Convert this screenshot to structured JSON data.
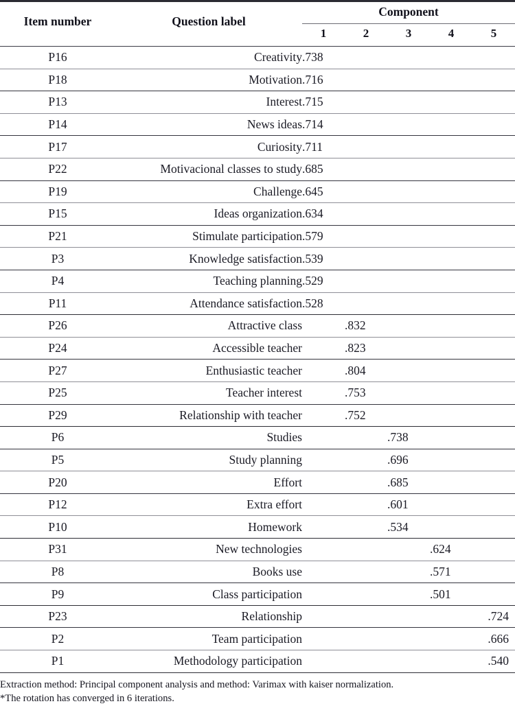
{
  "table": {
    "headers": {
      "item_number": "Item number",
      "question_label": "Question label",
      "component": "Component",
      "components": [
        "1",
        "2",
        "3",
        "4",
        "5"
      ]
    },
    "rows": [
      {
        "item": "P16",
        "label": "Creativity",
        "c1": ".738",
        "c2": "",
        "c3": "",
        "c4": "",
        "c5": ""
      },
      {
        "item": "P18",
        "label": "Motivation",
        "c1": ".716",
        "c2": "",
        "c3": "",
        "c4": "",
        "c5": ""
      },
      {
        "item": "P13",
        "label": "Interest",
        "c1": ".715",
        "c2": "",
        "c3": "",
        "c4": "",
        "c5": ""
      },
      {
        "item": "P14",
        "label": "News ideas",
        "c1": ".714",
        "c2": "",
        "c3": "",
        "c4": "",
        "c5": ""
      },
      {
        "item": "P17",
        "label": "Curiosity",
        "c1": ".711",
        "c2": "",
        "c3": "",
        "c4": "",
        "c5": ""
      },
      {
        "item": "P22",
        "label": "Motivacional classes to study",
        "c1": ".685",
        "c2": "",
        "c3": "",
        "c4": "",
        "c5": ""
      },
      {
        "item": "P19",
        "label": "Challenge",
        "c1": ".645",
        "c2": "",
        "c3": "",
        "c4": "",
        "c5": ""
      },
      {
        "item": "P15",
        "label": "Ideas organization",
        "c1": ".634",
        "c2": "",
        "c3": "",
        "c4": "",
        "c5": ""
      },
      {
        "item": "P21",
        "label": "Stimulate participation",
        "c1": ".579",
        "c2": "",
        "c3": "",
        "c4": "",
        "c5": ""
      },
      {
        "item": "P3",
        "label": "Knowledge satisfaction",
        "c1": ".539",
        "c2": "",
        "c3": "",
        "c4": "",
        "c5": ""
      },
      {
        "item": "P4",
        "label": "Teaching planning",
        "c1": ".529",
        "c2": "",
        "c3": "",
        "c4": "",
        "c5": ""
      },
      {
        "item": "P11",
        "label": "Attendance satisfaction",
        "c1": ".528",
        "c2": "",
        "c3": "",
        "c4": "",
        "c5": ""
      },
      {
        "item": "P26",
        "label": "Attractive class",
        "c1": "",
        "c2": ".832",
        "c3": "",
        "c4": "",
        "c5": ""
      },
      {
        "item": "P24",
        "label": "Accessible teacher",
        "c1": "",
        "c2": ".823",
        "c3": "",
        "c4": "",
        "c5": ""
      },
      {
        "item": "P27",
        "label": "Enthusiastic teacher",
        "c1": "",
        "c2": ".804",
        "c3": "",
        "c4": "",
        "c5": ""
      },
      {
        "item": "P25",
        "label": "Teacher interest",
        "c1": "",
        "c2": ".753",
        "c3": "",
        "c4": "",
        "c5": ""
      },
      {
        "item": "P29",
        "label": "Relationship with teacher",
        "c1": "",
        "c2": ".752",
        "c3": "",
        "c4": "",
        "c5": ""
      },
      {
        "item": "P6",
        "label": "Studies",
        "c1": "",
        "c2": "",
        "c3": ".738",
        "c4": "",
        "c5": ""
      },
      {
        "item": "P5",
        "label": "Study planning",
        "c1": "",
        "c2": "",
        "c3": ".696",
        "c4": "",
        "c5": ""
      },
      {
        "item": "P20",
        "label": "Effort",
        "c1": "",
        "c2": "",
        "c3": ".685",
        "c4": "",
        "c5": ""
      },
      {
        "item": "P12",
        "label": "Extra effort",
        "c1": "",
        "c2": "",
        "c3": ".601",
        "c4": "",
        "c5": ""
      },
      {
        "item": "P10",
        "label": "Homework",
        "c1": "",
        "c2": "",
        "c3": ".534",
        "c4": "",
        "c5": ""
      },
      {
        "item": "P31",
        "label": "New technologies",
        "c1": "",
        "c2": "",
        "c3": "",
        "c4": ".624",
        "c5": ""
      },
      {
        "item": "P8",
        "label": "Books use",
        "c1": "",
        "c2": "",
        "c3": "",
        "c4": ".571",
        "c5": ""
      },
      {
        "item": "P9",
        "label": "Class participation",
        "c1": "",
        "c2": "",
        "c3": "",
        "c4": ".501",
        "c5": ""
      },
      {
        "item": "P23",
        "label": "Relationship",
        "c1": "",
        "c2": "",
        "c3": "",
        "c4": "",
        "c5": ".724"
      },
      {
        "item": "P2",
        "label": "Team participation",
        "c1": "",
        "c2": "",
        "c3": "",
        "c4": "",
        "c5": ".666"
      },
      {
        "item": "P1",
        "label": "Methodology participation",
        "c1": "",
        "c2": "",
        "c3": "",
        "c4": "",
        "c5": ".540"
      }
    ]
  },
  "footnotes": [
    "Extraction method: Principal component analysis and method: Varimax with kaiser normalization.",
    "*The rotation has converged in 6 iterations."
  ],
  "chart_data": {
    "type": "table",
    "title": "Rotated component matrix of question items",
    "columns": [
      "Item number",
      "Question label",
      "1",
      "2",
      "3",
      "4",
      "5"
    ],
    "column_group": "Component",
    "rows": [
      [
        "P16",
        "Creativity",
        0.738,
        null,
        null,
        null,
        null
      ],
      [
        "P18",
        "Motivation",
        0.716,
        null,
        null,
        null,
        null
      ],
      [
        "P13",
        "Interest",
        0.715,
        null,
        null,
        null,
        null
      ],
      [
        "P14",
        "News ideas",
        0.714,
        null,
        null,
        null,
        null
      ],
      [
        "P17",
        "Curiosity",
        0.711,
        null,
        null,
        null,
        null
      ],
      [
        "P22",
        "Motivacional classes to study",
        0.685,
        null,
        null,
        null,
        null
      ],
      [
        "P19",
        "Challenge",
        0.645,
        null,
        null,
        null,
        null
      ],
      [
        "P15",
        "Ideas organization",
        0.634,
        null,
        null,
        null,
        null
      ],
      [
        "P21",
        "Stimulate participation",
        0.579,
        null,
        null,
        null,
        null
      ],
      [
        "P3",
        "Knowledge satisfaction",
        0.539,
        null,
        null,
        null,
        null
      ],
      [
        "P4",
        "Teaching planning",
        0.529,
        null,
        null,
        null,
        null
      ],
      [
        "P11",
        "Attendance satisfaction",
        0.528,
        null,
        null,
        null,
        null
      ],
      [
        "P26",
        "Attractive class",
        null,
        0.832,
        null,
        null,
        null
      ],
      [
        "P24",
        "Accessible teacher",
        null,
        0.823,
        null,
        null,
        null
      ],
      [
        "P27",
        "Enthusiastic teacher",
        null,
        0.804,
        null,
        null,
        null
      ],
      [
        "P25",
        "Teacher interest",
        null,
        0.753,
        null,
        null,
        null
      ],
      [
        "P29",
        "Relationship with teacher",
        null,
        0.752,
        null,
        null,
        null
      ],
      [
        "P6",
        "Studies",
        null,
        null,
        0.738,
        null,
        null
      ],
      [
        "P5",
        "Study planning",
        null,
        null,
        0.696,
        null,
        null
      ],
      [
        "P20",
        "Effort",
        null,
        null,
        0.685,
        null,
        null
      ],
      [
        "P12",
        "Extra effort",
        null,
        null,
        0.601,
        null,
        null
      ],
      [
        "P10",
        "Homework",
        null,
        null,
        0.534,
        null,
        null
      ],
      [
        "P31",
        "New technologies",
        null,
        null,
        null,
        0.624,
        null
      ],
      [
        "P8",
        "Books use",
        null,
        null,
        null,
        0.571,
        null
      ],
      [
        "P9",
        "Class participation",
        null,
        null,
        null,
        0.501,
        null
      ],
      [
        "P23",
        "Relationship",
        null,
        null,
        null,
        null,
        0.724
      ],
      [
        "P2",
        "Team participation",
        null,
        null,
        null,
        null,
        0.666
      ],
      [
        "P1",
        "Methodology participation",
        null,
        null,
        null,
        null,
        0.54
      ]
    ],
    "notes": [
      "Extraction method: Principal component analysis and method: Varimax with kaiser normalization.",
      "*The rotation has converged in 6 iterations."
    ]
  }
}
